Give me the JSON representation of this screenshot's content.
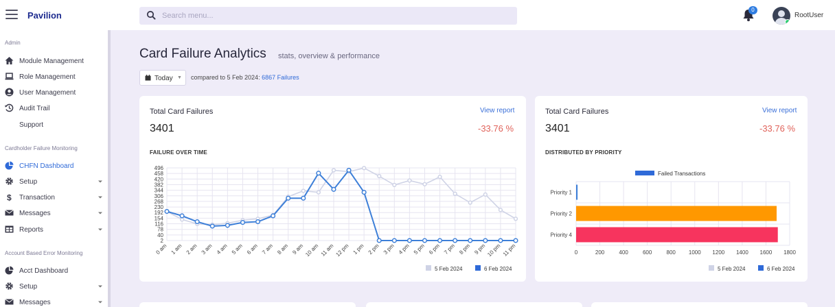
{
  "topbar": {
    "brand": "Pavilion",
    "search_placeholder": "Search menu...",
    "notifications_count": "0",
    "username": "RootUser"
  },
  "sidebar": {
    "sections": [
      {
        "title": "Admin",
        "items": [
          {
            "label": "Module Management",
            "icon": "home-icon"
          },
          {
            "label": "Role Management",
            "icon": "laptop-icon"
          },
          {
            "label": "User Management",
            "icon": "user-circle-icon"
          },
          {
            "label": "Audit Trail",
            "icon": "history-icon"
          },
          {
            "label": "Support",
            "icon": ""
          }
        ]
      },
      {
        "title": "Cardholder Failure Monitoring",
        "items": [
          {
            "label": "CHFN Dashboard",
            "icon": "pie-chart-icon",
            "active": true
          },
          {
            "label": "Setup",
            "icon": "gear-icon",
            "expandable": true
          },
          {
            "label": "Transaction",
            "icon": "dollar-icon",
            "expandable": true
          },
          {
            "label": "Messages",
            "icon": "envelope-icon",
            "expandable": true
          },
          {
            "label": "Reports",
            "icon": "table-icon",
            "expandable": true
          }
        ]
      },
      {
        "title": "Account Based Error Monitoring",
        "items": [
          {
            "label": "Acct Dashboard",
            "icon": "pie-chart-icon"
          },
          {
            "label": "Setup",
            "icon": "gear-icon",
            "expandable": true
          },
          {
            "label": "Messages",
            "icon": "envelope-icon",
            "expandable": true
          }
        ]
      }
    ]
  },
  "page": {
    "title": "Card Failure Analytics",
    "subtitle": "stats, overview & performance",
    "date_button": "Today",
    "compare_prefix": "compared to 5 Feb 2024:",
    "compare_value": "6867 Failures"
  },
  "cards": [
    {
      "title": "Total Card Failures",
      "link": "View report",
      "value": "3401",
      "change": "-33.76 %",
      "subtitle": "FAILURE OVER TIME"
    },
    {
      "title": "Total Card Failures",
      "link": "View report",
      "value": "3401",
      "change": "-33.76 %",
      "subtitle": "DISTRIBUTED BY PRIORITY"
    }
  ],
  "colors": {
    "accent": "#2f6ad8",
    "line_today": "#3d7fd8",
    "line_compare": "#cfd3e6",
    "priority_2": "#ff9800",
    "priority_4": "#f7345e",
    "priority_1": "#3d7fd8",
    "change_negative": "#e0625a"
  },
  "chart_data": [
    {
      "type": "line",
      "title": "",
      "x": [
        "0 am",
        "1 am",
        "2 am",
        "3 am",
        "4 am",
        "5 am",
        "6 am",
        "7 am",
        "8 am",
        "9 am",
        "10 am",
        "11 am",
        "12 pm",
        "1 pm",
        "2 pm",
        "3 pm",
        "4 pm",
        "5 pm",
        "6 pm",
        "7 pm",
        "8 pm",
        "9 pm",
        "10 pm",
        "11 pm"
      ],
      "y_ticks": [
        2,
        40,
        78,
        116,
        154,
        192,
        230,
        268,
        306,
        344,
        382,
        420,
        458,
        496
      ],
      "ylim": [
        2,
        496
      ],
      "series": [
        {
          "name": "5 Feb 2024",
          "values": [
            200,
            145,
            115,
            110,
            120,
            140,
            150,
            175,
            300,
            340,
            330,
            480,
            470,
            495,
            440,
            380,
            410,
            385,
            435,
            320,
            260,
            315,
            210,
            150
          ]
        },
        {
          "name": "6 Feb 2024",
          "values": [
            200,
            170,
            130,
            100,
            105,
            125,
            130,
            170,
            290,
            290,
            460,
            350,
            480,
            330,
            2,
            2,
            2,
            2,
            2,
            2,
            2,
            2,
            2,
            2
          ]
        }
      ],
      "legend": "bottom-right"
    },
    {
      "type": "bar",
      "orientation": "horizontal",
      "title": "",
      "categories": [
        "Priority 1",
        "Priority 2",
        "Priority 4"
      ],
      "x_ticks": [
        0,
        200,
        400,
        600,
        800,
        1000,
        1200,
        1400,
        1600,
        1800
      ],
      "xlim": [
        0,
        1800
      ],
      "series": [
        {
          "name": "Failed Transactions",
          "values": [
            12,
            1690,
            1700
          ]
        }
      ],
      "legend_top": "Failed Transactions",
      "legend_bottom": [
        "5 Feb 2024",
        "6 Feb 2024"
      ]
    }
  ]
}
